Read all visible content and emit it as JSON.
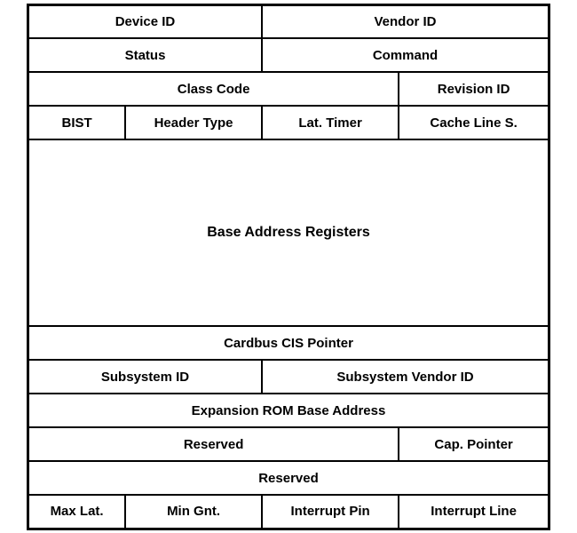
{
  "table": {
    "rows": {
      "device_id": "Device ID",
      "vendor_id": "Vendor ID",
      "status": "Status",
      "command": "Command",
      "class_code": "Class Code",
      "revision_id": "Revision ID",
      "bist": "BIST",
      "header_type": "Header Type",
      "lat_timer": "Lat. Timer",
      "cache_line": "Cache Line S.",
      "bar": "Base Address Registers",
      "cardbus": "Cardbus CIS Pointer",
      "subsystem_id": "Subsystem ID",
      "subsystem_vendor": "Subsystem Vendor ID",
      "expansion_rom": "Expansion ROM Base Address",
      "reserved1": "Reserved",
      "cap_pointer": "Cap. Pointer",
      "reserved2": "Reserved",
      "max_lat": "Max Lat.",
      "min_gnt": "Min Gnt.",
      "interrupt_pin": "Interrupt Pin",
      "interrupt_line": "Interrupt Line"
    }
  }
}
